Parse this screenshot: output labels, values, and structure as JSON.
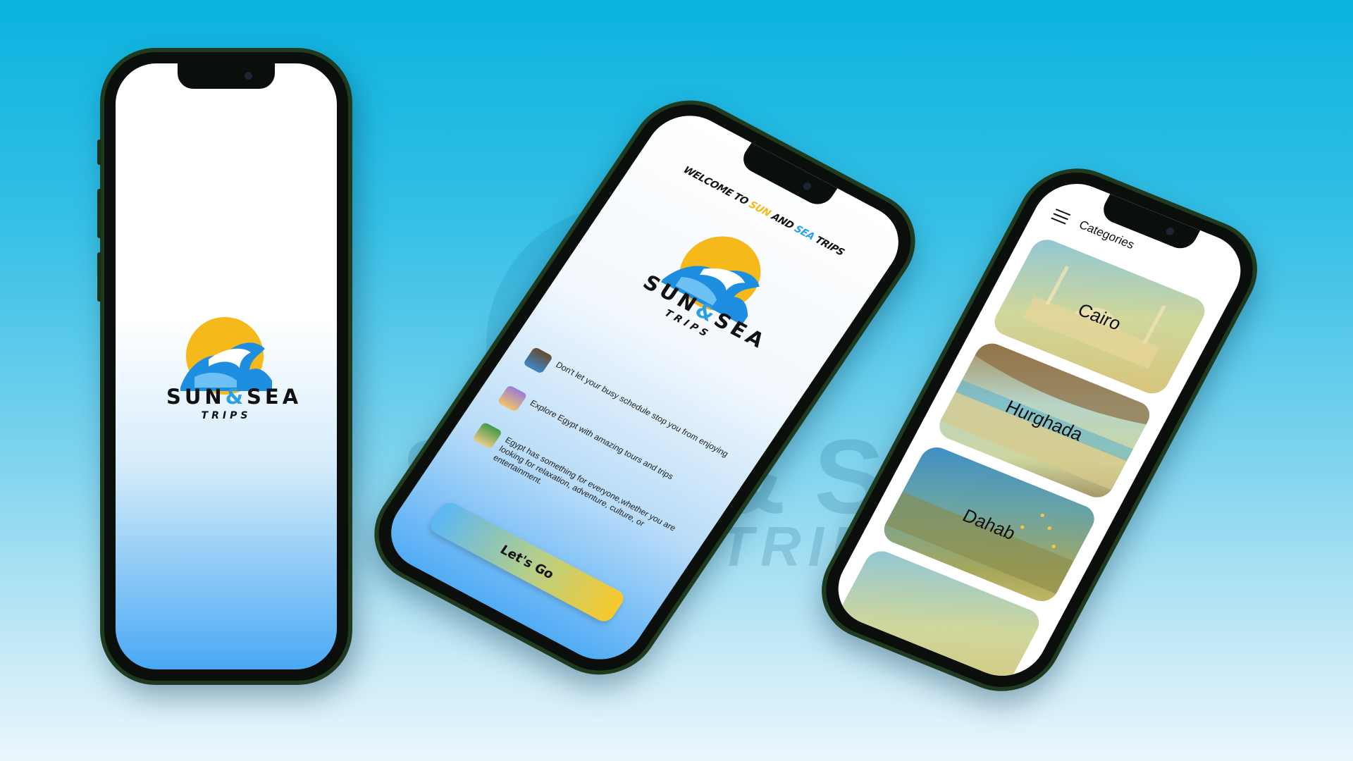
{
  "brand": {
    "name_left": "SUN",
    "ampersand": "&",
    "name_right": "SEA",
    "subtitle": "TRIPS",
    "colors": {
      "sun": "#f6b91c",
      "sea": "#2ba0e6",
      "frame": "#1f3a1e"
    }
  },
  "background": {
    "watermark_word": "SUN&SEA",
    "watermark_sub": "TRIPS"
  },
  "splash": {
    "screen": "splash"
  },
  "welcome": {
    "title_prefix": "WELCOME TO ",
    "title_sun": "SUN",
    "title_and": " AND ",
    "title_sea": "SEA",
    "title_suffix": " TRIPS",
    "features": [
      {
        "icon": "busy-person-icon",
        "text": "Don't let your busy schedule stop you from enjoying"
      },
      {
        "icon": "calendar-icon",
        "text": "Explore Egypt with amazing tours and trips"
      },
      {
        "icon": "island-icon",
        "text": "Egypt has something for everyone,whether you are looking for relaxation, adventure, culture, or entertainment."
      }
    ],
    "cta_label": "Let's Go"
  },
  "categories": {
    "header_title": "Categories",
    "menu_icon": "hamburger-menu-icon",
    "items": [
      {
        "label": "Cairo"
      },
      {
        "label": "Hurghada"
      },
      {
        "label": "Dahab"
      },
      {
        "label": ""
      }
    ]
  }
}
